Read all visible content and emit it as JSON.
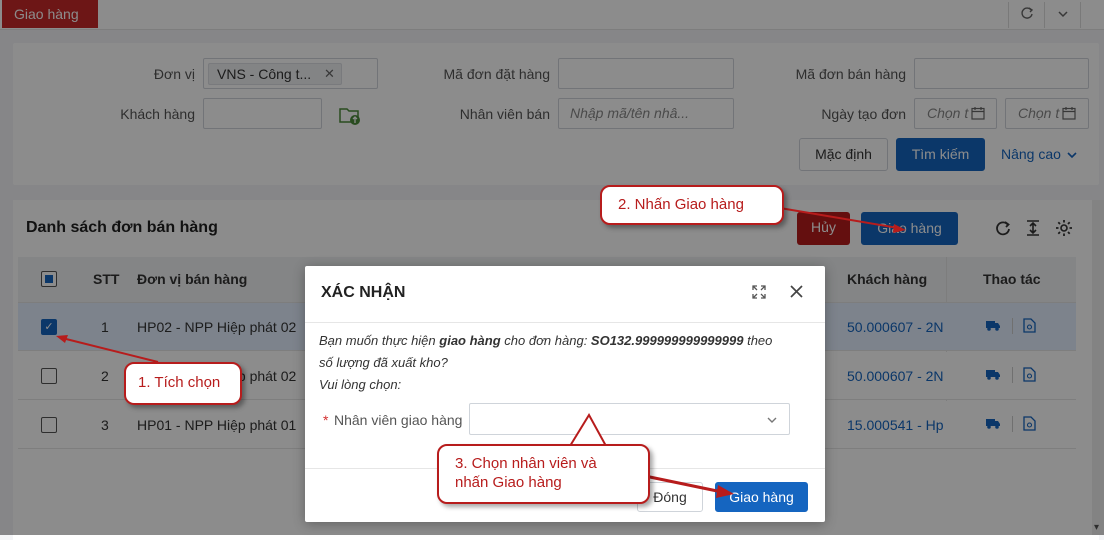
{
  "topbar": {
    "tab_label": "Giao hàng"
  },
  "filters": {
    "don_vi_label": "Đơn vị",
    "don_vi_value": "VNS - Công t...",
    "khach_hang_label": "Khách hàng",
    "ma_don_dat_hang_label": "Mã đơn đặt hàng",
    "nhan_vien_ban_label": "Nhân viên bán",
    "nhan_vien_ban_placeholder": "Nhập mã/tên nhâ...",
    "ma_don_ban_hang_label": "Mã đơn bán hàng",
    "ngay_tao_don_label": "Ngày tạo đơn",
    "date_from_placeholder": "Chọn t",
    "date_to_placeholder": "Chọn t",
    "mac_dinh_label": "Mặc định",
    "tim_kiem_label": "Tìm kiếm",
    "nang_cao_label": "Nâng cao"
  },
  "list": {
    "title": "Danh sách đơn bán hàng",
    "huy_label": "Hủy",
    "giao_hang_label": "Giao hàng",
    "headers": {
      "stt": "STT",
      "don_vi": "Đơn vị bán hàng",
      "khach_hang": "Khách hàng",
      "thao_tac": "Thao tác"
    },
    "rows": [
      {
        "stt": "1",
        "don_vi": "HP02 - NPP Hiệp phát 02",
        "khach_hang": "50.000607 - 2N",
        "checked": true
      },
      {
        "stt": "2",
        "don_vi": "HP02 - NPP Hiệp phát 02",
        "khach_hang": "50.000607 - 2N",
        "checked": false
      },
      {
        "stt": "3",
        "don_vi": "HP01 - NPP Hiệp phát 01",
        "khach_hang": "15.000541 - Hp",
        "checked": false
      }
    ]
  },
  "modal": {
    "title": "XÁC NHẬN",
    "line1_pre": "Bạn muốn thực hiện ",
    "line1_bold": "giao hàng",
    "line1_mid": " cho đơn hàng: ",
    "line1_order": "SO132.999999999999999",
    "line1_post": " theo",
    "line2": "số lượng đã xuất kho?",
    "line3": "Vui lòng chọn:",
    "required_mark": "*",
    "field_label": "Nhân viên giao hàng",
    "close_label": "Đóng",
    "confirm_label": "Giao hàng"
  },
  "callouts": {
    "step1": "1. Tích chọn",
    "step2": "2. Nhấn Giao hàng",
    "step3_line1": "3. Chọn nhân viên và",
    "step3_line2": "nhấn Giao hàng"
  },
  "colors": {
    "accent": "#1565c0",
    "brand_red": "#c62828",
    "callout": "#b71c1c"
  }
}
